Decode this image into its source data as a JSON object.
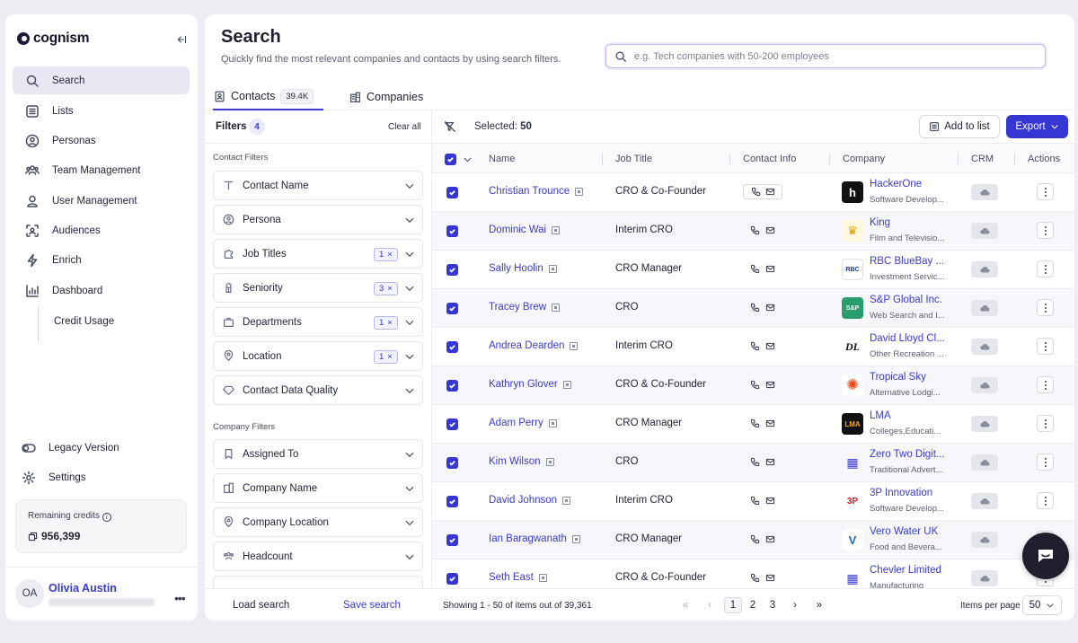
{
  "app": {
    "brand": "cognism"
  },
  "sidebar": {
    "nav": [
      {
        "label": "Search",
        "icon": "search-icon"
      },
      {
        "label": "Lists",
        "icon": "list-icon"
      },
      {
        "label": "Personas",
        "icon": "persona-icon"
      },
      {
        "label": "Team Management",
        "icon": "team-icon"
      },
      {
        "label": "User Management",
        "icon": "user-icon"
      },
      {
        "label": "Audiences",
        "icon": "audience-icon"
      },
      {
        "label": "Enrich",
        "icon": "bolt-icon"
      },
      {
        "label": "Dashboard",
        "icon": "dashboard-icon"
      },
      {
        "label": "Credit Usage",
        "icon": ""
      }
    ],
    "legacy": "Legacy Version",
    "settings": "Settings",
    "credits_label": "Remaining credits",
    "credits_value": "956,399",
    "user": {
      "initials": "OA",
      "name": "Olivia Austin"
    }
  },
  "header": {
    "title": "Search",
    "subtitle": "Quickly find the most relevant companies and contacts by using search filters.",
    "search_placeholder": "e.g. Tech companies with 50-200 employees"
  },
  "tabs": [
    {
      "label": "Contacts",
      "count": "39.4K"
    },
    {
      "label": "Companies"
    }
  ],
  "filters": {
    "title": "Filters",
    "count": "4",
    "clear": "Clear all",
    "contact_section": "Contact Filters",
    "company_section": "Company Filters",
    "contact_items": [
      {
        "label": "Contact Name",
        "badge": ""
      },
      {
        "label": "Persona",
        "badge": ""
      },
      {
        "label": "Job Titles",
        "badge": "1"
      },
      {
        "label": "Seniority",
        "badge": "3"
      },
      {
        "label": "Departments",
        "badge": "1"
      },
      {
        "label": "Location",
        "badge": "1"
      },
      {
        "label": "Contact Data Quality",
        "badge": ""
      }
    ],
    "company_items": [
      {
        "label": "Assigned To"
      },
      {
        "label": "Company Name"
      },
      {
        "label": "Company Location"
      },
      {
        "label": "Headcount"
      }
    ],
    "load": "Load search",
    "save": "Save search"
  },
  "table": {
    "selected_label": "Selected:",
    "selected_count": "50",
    "add_to_list": "Add to list",
    "export": "Export",
    "columns": [
      "Name",
      "Job Title",
      "Contact Info",
      "Company",
      "CRM",
      "Actions"
    ],
    "rows": [
      {
        "name": "Christian Trounce",
        "job": "CRO & Co-Founder",
        "company": "HackerOne",
        "industry": "Software Develop...",
        "logo": "h"
      },
      {
        "name": "Dominic Wai",
        "job": "Interim CRO",
        "company": "King",
        "industry": "Film and Televisio...",
        "logo": "♛"
      },
      {
        "name": "Sally Hoolin",
        "job": "CRO Manager",
        "company": "RBC BlueBay ...",
        "industry": "Investment Servic...",
        "logo": "RBC"
      },
      {
        "name": "Tracey Brew",
        "job": "CRO",
        "company": "S&P Global Inc.",
        "industry": "Web Search and I...",
        "logo": "S&P"
      },
      {
        "name": "Andrea Dearden",
        "job": "Interim CRO",
        "company": "David Lloyd Cl...",
        "industry": "Other Recreation ...",
        "logo": "DL"
      },
      {
        "name": "Kathryn Glover",
        "job": "CRO & Co-Founder",
        "company": "Tropical Sky",
        "industry": "Alternative Lodgi...",
        "logo": "✺"
      },
      {
        "name": "Adam Perry",
        "job": "CRO Manager",
        "company": "LMA",
        "industry": "Colleges,Educati...",
        "logo": "LMA"
      },
      {
        "name": "Kim Wilson",
        "job": "CRO",
        "company": "Zero Two Digit...",
        "industry": "Traditional Advert...",
        "logo": "▦"
      },
      {
        "name": "David Johnson",
        "job": "Interim CRO",
        "company": "3P Innovation",
        "industry": "Software Develop...",
        "logo": "3P"
      },
      {
        "name": "Ian Baragwanath",
        "job": "CRO Manager",
        "company": "Vero Water UK",
        "industry": "Food and Bevera...",
        "logo": "V"
      },
      {
        "name": "Seth East",
        "job": "CRO & Co-Founder",
        "company": "Chevler Limited",
        "industry": "Manufacturing",
        "logo": "▦"
      }
    ],
    "footer": {
      "showing": "Showing 1 - 50 of items out of 39,361",
      "pages": [
        "1",
        "2",
        "3"
      ],
      "items_per_page_label": "Items per page",
      "items_per_page": "50"
    }
  },
  "colors": {
    "accent": "#3636d2",
    "link": "#3b3ad0"
  }
}
